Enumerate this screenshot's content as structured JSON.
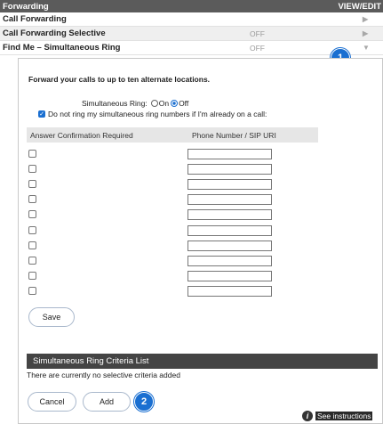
{
  "header": {
    "title": "Forwarding",
    "action": "VIEW/EDIT"
  },
  "rows": [
    {
      "label": "Call Forwarding",
      "status": "",
      "arrow": "▶"
    },
    {
      "label": "Call Forwarding Selective",
      "status": "OFF",
      "arrow": "▶"
    },
    {
      "label": "Find Me – Simultaneous Ring",
      "status": "OFF",
      "arrow": "▼"
    }
  ],
  "badges": {
    "one": "1",
    "two": "2"
  },
  "panel": {
    "intro": "Forward your calls to up to ten alternate locations.",
    "simring_label": "Simultaneous Ring:",
    "on_label": "On",
    "off_label": "Off",
    "selected": "Off",
    "dont_ring_label": "Do not ring my simultaneous ring numbers if I'm already on a call:",
    "dont_ring_checked": true,
    "table": {
      "col1": "Answer Confirmation Required",
      "col2": "Phone Number / SIP URI",
      "rows": [
        "",
        "",
        "",
        "",
        "",
        "",
        "",
        "",
        "",
        ""
      ]
    },
    "save_label": "Save",
    "criteria_title": "Simultaneous Ring Criteria List",
    "no_criteria": "There are currently no selective criteria added",
    "cancel_label": "Cancel",
    "add_label": "Add",
    "instructions_label": "See instructions",
    "info_glyph": "i"
  },
  "colors": {
    "accent": "#1a6fd1",
    "header_bg": "#5b5b5b",
    "criteria_bg": "#444444"
  }
}
